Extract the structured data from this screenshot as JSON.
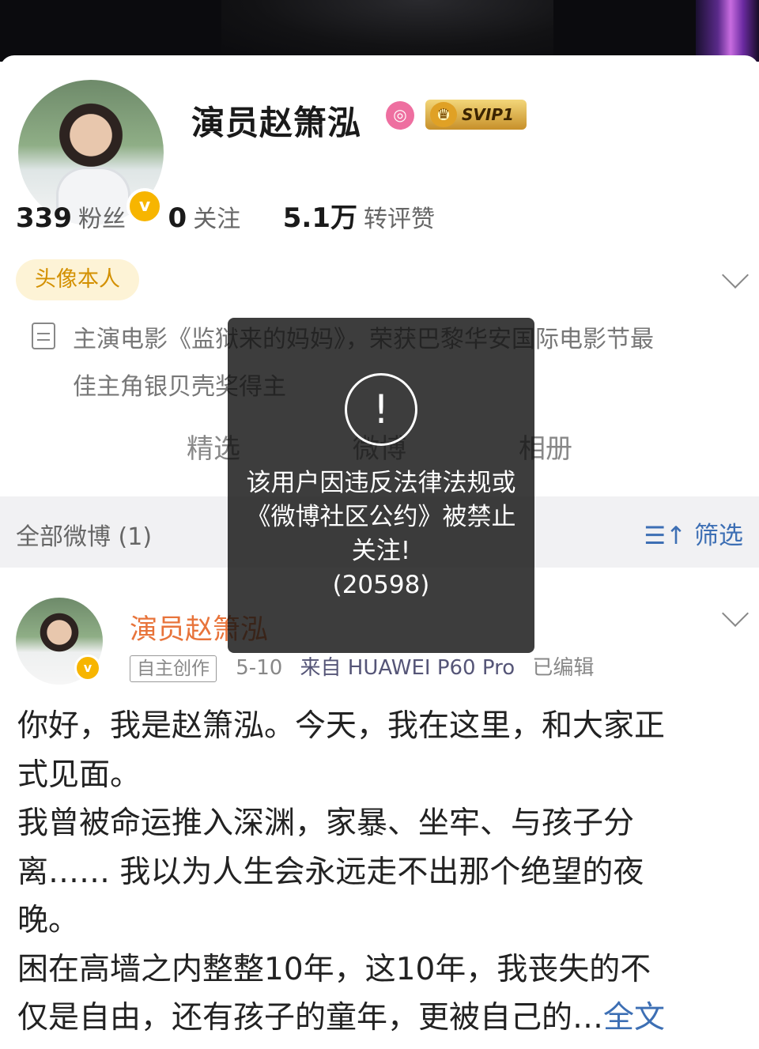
{
  "profile": {
    "name": "演员赵箫泓",
    "vip_label": "SVIP1",
    "stats": [
      {
        "value": "339",
        "label": "粉丝"
      },
      {
        "value": "0",
        "label": "关注"
      },
      {
        "value": "5.1万",
        "label": "转评赞"
      }
    ],
    "tag": "头像本人",
    "bio_line1": "主演电影《监狱来的妈妈》，荣获巴黎华安国际电影节最",
    "bio_line2": "佳主角银贝壳奖得主",
    "tabs": [
      "精选",
      "微博",
      "相册"
    ]
  },
  "filter_bar": {
    "all_posts": "全部微博 (1)",
    "filter_label": "筛选",
    "filter_icon": "filter-sort-icon"
  },
  "post": {
    "author": "演员赵箫泓",
    "original_tag": "自主创作",
    "date": "5-10",
    "source": "来自 HUAWEI P60 Pro",
    "edited": "已编辑",
    "lines": [
      "你好，我是赵箫泓。今天，我在这里，和大家正",
      "式见面。",
      "我曾被命运推入深渊，家暴、坐牢、与孩子分",
      "离…… 我以为人生会永远走不出那个绝望的夜",
      "晚。",
      "困在高墙之内整整10年，这10年，我丧失的不"
    ],
    "last_line": "仅是自由，还有孩子的童年，更被自己的…",
    "more": "全文"
  },
  "toast": {
    "icon": "exclamation-circle-icon",
    "message": "该用户因违反法律法规或《微博社区公约》被禁止关注!",
    "code": "(20598)"
  },
  "colors": {
    "accent_blue": "#3d6fb4",
    "author_orange": "#e8743b",
    "tag_gold": "#d39000",
    "verified_yellow": "#f7b500"
  }
}
